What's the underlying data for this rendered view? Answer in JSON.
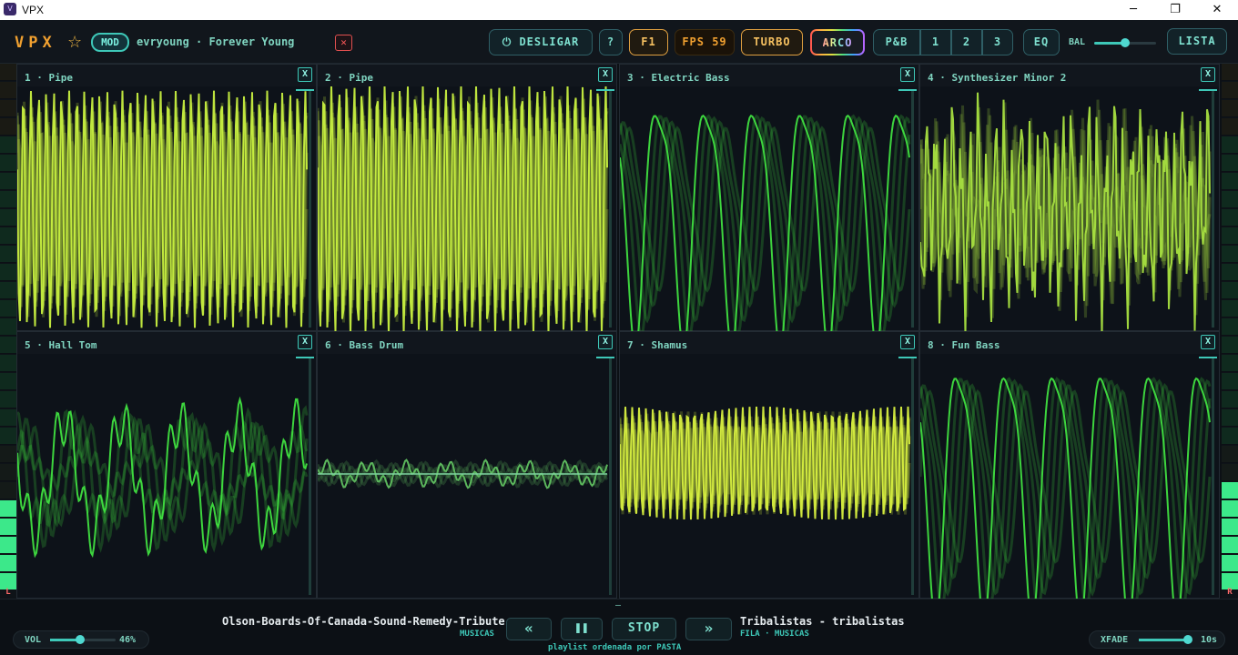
{
  "window": {
    "title": "VPX",
    "icon": "vpx-app-icon",
    "minimize": "─",
    "maximize": "❐",
    "close": "✕"
  },
  "header": {
    "logo": "VPX",
    "favorite_icon": "☆",
    "mod_badge": "MOD",
    "track": "evryoung · Forever Young",
    "remove_icon": "✕",
    "buttons": {
      "power": "⏻ DESLIGAR",
      "help": "?",
      "f1": "F1",
      "fps": "FPS 59",
      "turbo": "TURBO",
      "arco": "ARCO",
      "pb": "P&B",
      "preset1": "1",
      "preset2": "2",
      "preset3": "3",
      "eq": "EQ",
      "lista": "LISTA"
    },
    "balance": {
      "label": "BAL",
      "value": 0.5
    }
  },
  "colors": {
    "accent": "#3ec8b8",
    "orange": "#f0a030",
    "lime": "#c8f040",
    "green": "#40e040",
    "meter": "#3ce88a"
  },
  "panels": [
    {
      "title": "1 · Pipe",
      "close": "X",
      "color": "#c8f040"
    },
    {
      "title": "2 · Pipe",
      "close": "X",
      "color": "#c8f040"
    },
    {
      "title": "3 · Electric Bass",
      "close": "X",
      "color": "#40e040"
    },
    {
      "title": "4 · Synthesizer Minor 2",
      "close": "X",
      "color": "#a8e040"
    },
    {
      "title": "5 · Hall Tom",
      "close": "X",
      "color": "#40e040"
    },
    {
      "title": "6 · Bass Drum",
      "close": "X",
      "color": "#60c060"
    },
    {
      "title": "7 · Shamus",
      "close": "X",
      "color": "#d8f040"
    },
    {
      "title": "8 · Fun Bass",
      "close": "X",
      "color": "#40e040"
    }
  ],
  "vu": {
    "left_label": "L",
    "right_label": "R",
    "left_level": 0.16,
    "right_level": 0.2
  },
  "footer": {
    "volume": {
      "label": "VOL",
      "value_text": "46%",
      "value": 0.46
    },
    "prev_track": {
      "title": "Olson-Boards-Of-Canada-Sound-Remedy-Tribute",
      "source": "MUSICAS"
    },
    "next_track": {
      "title": "Tribalistas - tribalistas",
      "source": "FILA · MUSICAS"
    },
    "controls": {
      "rewind": "«",
      "pause": "❚❚",
      "stop": "STOP",
      "forward": "»"
    },
    "dash": "–",
    "status": "playlist ordenada por PASTA",
    "xfade": {
      "label": "XFADE",
      "value_text": "10s",
      "value": 1.0
    }
  }
}
